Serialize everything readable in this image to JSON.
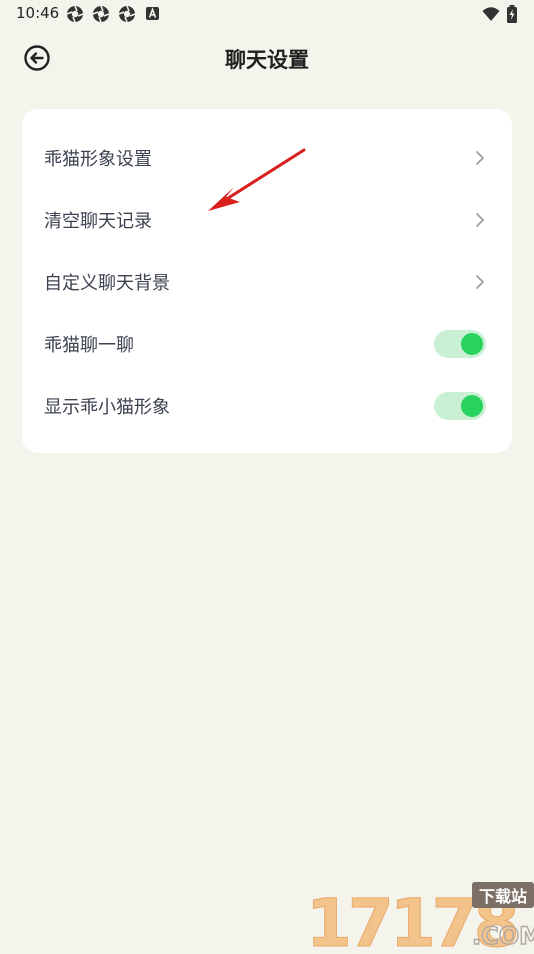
{
  "status_bar": {
    "time": "10:46",
    "left_icons": [
      "aperture-icon",
      "aperture-icon",
      "aperture-icon",
      "a-badge-icon"
    ],
    "right_icons": [
      "wifi-icon",
      "battery-charging-icon"
    ]
  },
  "header": {
    "title": "聊天设置",
    "back_icon": "back-arrow-circle-icon"
  },
  "settings": {
    "items": [
      {
        "label": "乖猫形象设置",
        "control": "chevron"
      },
      {
        "label": "清空聊天记录",
        "control": "chevron"
      },
      {
        "label": "自定义聊天背景",
        "control": "chevron"
      },
      {
        "label": "乖猫聊一聊",
        "control": "toggle",
        "on": true
      },
      {
        "label": "显示乖小猫形象",
        "control": "toggle",
        "on": true
      }
    ]
  },
  "colors": {
    "background": "#f4f4ec",
    "card": "#ffffff",
    "toggle_track": "#c9f0d3",
    "toggle_knob": "#27d35d",
    "annotation": "#d9201f"
  },
  "watermark": {
    "brand": "17178",
    "tag": "下载站",
    "domain": ".COM"
  }
}
